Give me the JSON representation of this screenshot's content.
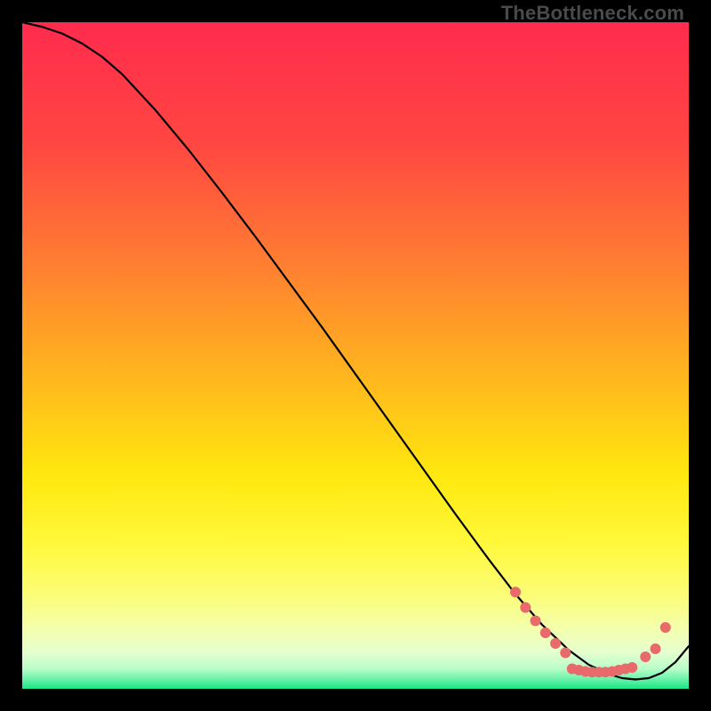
{
  "watermark": "TheBottleneck.com",
  "chart_data": {
    "type": "line",
    "title": "",
    "xlabel": "",
    "ylabel": "",
    "xlim": [
      0,
      100
    ],
    "ylim": [
      0,
      100
    ],
    "grid": false,
    "legend": false,
    "background_gradient": {
      "stops": [
        {
          "offset": 0.0,
          "color": "#ff2b4d"
        },
        {
          "offset": 0.18,
          "color": "#ff4642"
        },
        {
          "offset": 0.35,
          "color": "#ff7a33"
        },
        {
          "offset": 0.52,
          "color": "#ffb21f"
        },
        {
          "offset": 0.68,
          "color": "#ffe80f"
        },
        {
          "offset": 0.78,
          "color": "#fff83a"
        },
        {
          "offset": 0.86,
          "color": "#fbfd78"
        },
        {
          "offset": 0.91,
          "color": "#f4ffad"
        },
        {
          "offset": 0.945,
          "color": "#e6ffcf"
        },
        {
          "offset": 0.97,
          "color": "#b8fdc9"
        },
        {
          "offset": 0.985,
          "color": "#6ef2ab"
        },
        {
          "offset": 1.0,
          "color": "#17e884"
        }
      ]
    },
    "series": [
      {
        "name": "curve",
        "stroke": "#000000",
        "stroke_width": 2.2,
        "x": [
          0,
          3,
          6,
          9,
          12,
          15,
          20,
          25,
          30,
          35,
          40,
          45,
          50,
          55,
          60,
          65,
          70,
          74,
          78,
          82,
          85,
          88,
          90,
          92,
          94,
          96,
          98,
          100
        ],
        "y": [
          100,
          99.3,
          98.3,
          96.8,
          94.8,
          92.2,
          86.8,
          80.8,
          74.4,
          67.8,
          61.0,
          54.2,
          47.2,
          40.2,
          33.2,
          26.2,
          19.4,
          14.2,
          9.6,
          5.8,
          3.6,
          2.2,
          1.6,
          1.4,
          1.6,
          2.4,
          4.0,
          6.4
        ]
      }
    ],
    "markers": {
      "name": "highlight-dots",
      "color": "#e86a6a",
      "radius": 6,
      "points": [
        {
          "x": 74.0,
          "y": 14.5
        },
        {
          "x": 75.5,
          "y": 12.2
        },
        {
          "x": 77.0,
          "y": 10.2
        },
        {
          "x": 78.5,
          "y": 8.4
        },
        {
          "x": 80.0,
          "y": 6.8
        },
        {
          "x": 81.5,
          "y": 5.4
        },
        {
          "x": 82.5,
          "y": 3.0
        },
        {
          "x": 83.5,
          "y": 2.8
        },
        {
          "x": 84.5,
          "y": 2.6
        },
        {
          "x": 85.5,
          "y": 2.5
        },
        {
          "x": 86.5,
          "y": 2.5
        },
        {
          "x": 87.5,
          "y": 2.5
        },
        {
          "x": 88.5,
          "y": 2.6
        },
        {
          "x": 89.5,
          "y": 2.8
        },
        {
          "x": 90.5,
          "y": 3.0
        },
        {
          "x": 91.5,
          "y": 3.2
        },
        {
          "x": 93.5,
          "y": 4.8
        },
        {
          "x": 95.0,
          "y": 6.0
        },
        {
          "x": 96.5,
          "y": 9.2
        }
      ]
    }
  }
}
